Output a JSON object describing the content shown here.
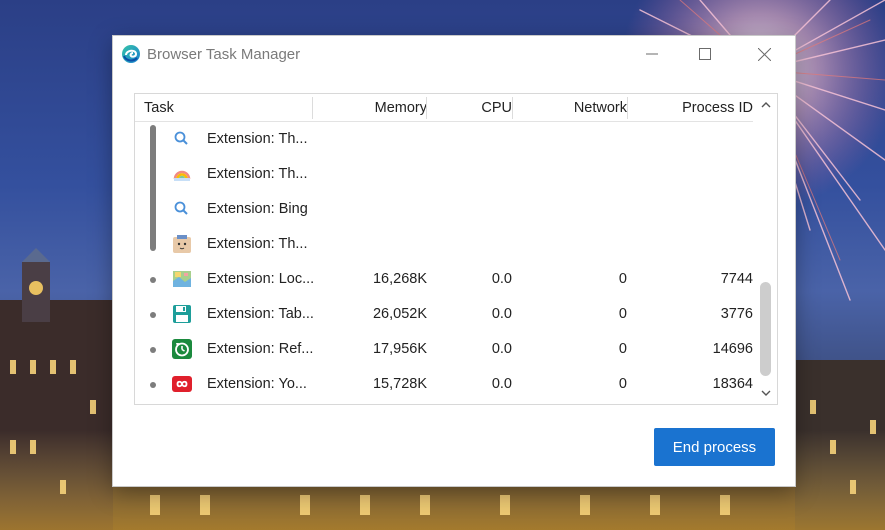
{
  "window": {
    "title": "Browser Task Manager",
    "app_icon": "edge-browser-icon",
    "controls": {
      "minimize": "minimize-icon",
      "maximize": "maximize-icon",
      "close": "close-icon"
    }
  },
  "table": {
    "columns": [
      "Task",
      "Memory",
      "CPU",
      "Network",
      "Process ID"
    ],
    "rows": [
      {
        "icon": "search-icon",
        "name": "Extension: Th...",
        "memory": "",
        "cpu": "",
        "network": "",
        "pid": "",
        "grouped": true
      },
      {
        "icon": "rainbow-icon",
        "name": "Extension: Th...",
        "memory": "",
        "cpu": "",
        "network": "",
        "pid": "",
        "grouped": true
      },
      {
        "icon": "search-icon",
        "name": "Extension: Bing",
        "memory": "",
        "cpu": "",
        "network": "",
        "pid": "",
        "grouped": true
      },
      {
        "icon": "box-face-icon",
        "name": "Extension: Th...",
        "memory": "",
        "cpu": "",
        "network": "",
        "pid": "",
        "grouped": true
      },
      {
        "icon": "map-icon",
        "name": "Extension: Loc...",
        "memory": "16,268K",
        "cpu": "0.0",
        "network": "0",
        "pid": "7744",
        "grouped": false
      },
      {
        "icon": "floppy-disk-icon",
        "name": "Extension: Tab...",
        "memory": "26,052K",
        "cpu": "0.0",
        "network": "0",
        "pid": "3776",
        "grouped": false
      },
      {
        "icon": "refresh-clock-icon",
        "name": "Extension: Ref...",
        "memory": "17,956K",
        "cpu": "0.0",
        "network": "0",
        "pid": "14696",
        "grouped": false
      },
      {
        "icon": "infinity-loop-icon",
        "name": "Extension: Yo...",
        "memory": "15,728K",
        "cpu": "0.0",
        "network": "0",
        "pid": "18364",
        "grouped": false
      }
    ]
  },
  "actions": {
    "end_process": "End process"
  },
  "colors": {
    "accent": "#1a73d0"
  }
}
